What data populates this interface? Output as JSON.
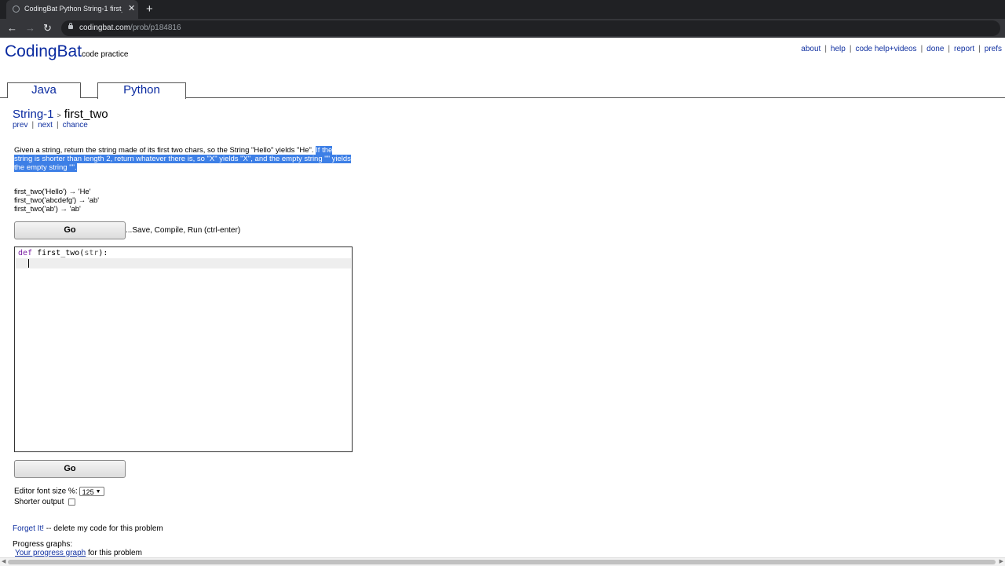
{
  "browser": {
    "tab_title": "CodingBat Python String-1 first_t",
    "close_glyph": "✕",
    "newtab_glyph": "+",
    "back_glyph": "←",
    "forward_glyph": "→",
    "reload_glyph": "↻",
    "url_host": "codingbat.com",
    "url_path": "/prob/p184816"
  },
  "header": {
    "logo": "CodingBat",
    "logo_sub": "code practice",
    "nav": [
      "about",
      "help",
      "code help+videos",
      "done",
      "report",
      "prefs"
    ]
  },
  "lang_tabs": [
    "Java",
    "Python"
  ],
  "breadcrumb": {
    "section": "String-1",
    "arrow": ">",
    "problem": "first_two"
  },
  "problem_nav": [
    "prev",
    "next",
    "chance"
  ],
  "description": {
    "plain": "Given a string, return the string made of its first two chars, so the String \"Hello\" yields \"He\".",
    "highlighted": "If the string is shorter than length 2, return whatever there is, so \"X\" yields \"X\", and the empty string \"\" yields the empty string \"\"."
  },
  "examples": [
    "first_two('Hello') → 'He'",
    "first_two('abcdefg') → 'ab'",
    "first_two('ab') → 'ab'"
  ],
  "go_label": "Go",
  "go_hint": "...Save, Compile, Run (ctrl-enter)",
  "editor": {
    "kw": "def",
    "fn": "first_two(",
    "param": "str",
    "end": "):"
  },
  "options": {
    "font_size_label": "Editor font size %:",
    "font_size_value": "125",
    "shorter_output_label": "Shorter output"
  },
  "forget": {
    "link": "Forget It!",
    "text": "-- delete my code for this problem"
  },
  "progress": {
    "heading": "Progress graphs:",
    "link": "Your progress graph",
    "text": "for this problem"
  }
}
